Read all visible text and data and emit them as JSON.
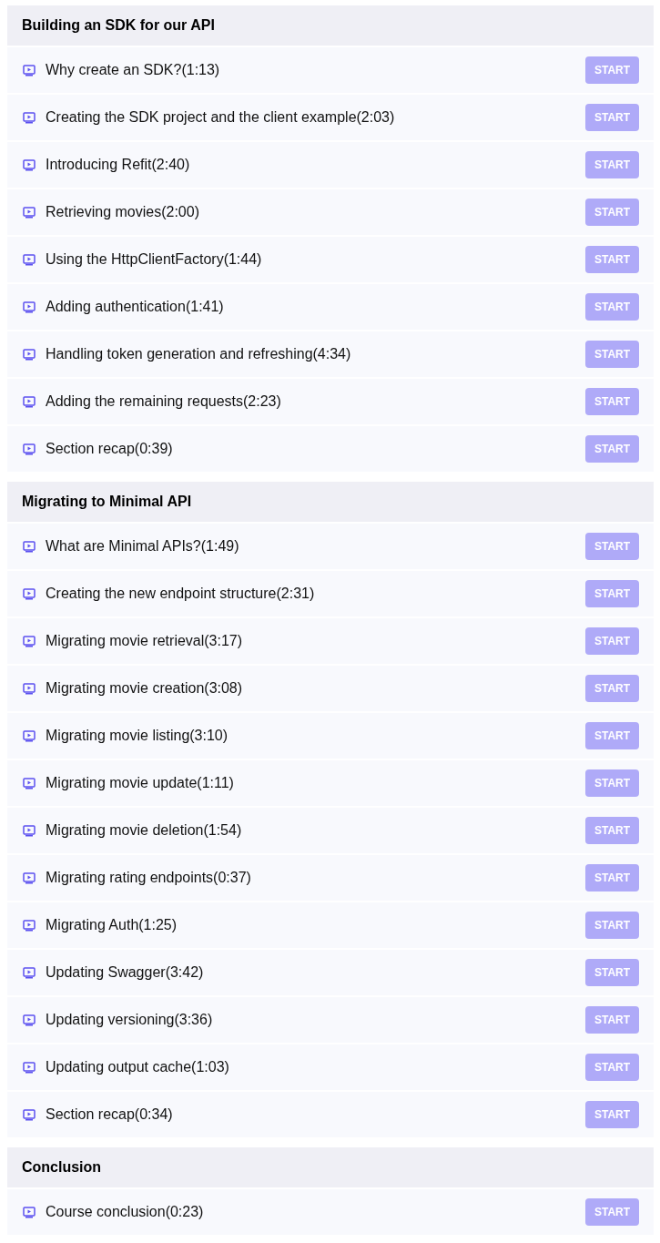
{
  "sections": [
    {
      "title": "Building an SDK for our API",
      "lessons": [
        {
          "title": "Why create an SDK?(1:13)",
          "button": "START"
        },
        {
          "title": "Creating the SDK project and the client example(2:03)",
          "button": "START"
        },
        {
          "title": "Introducing Refit(2:40)",
          "button": "START"
        },
        {
          "title": "Retrieving movies(2:00)",
          "button": "START"
        },
        {
          "title": "Using the HttpClientFactory(1:44)",
          "button": "START"
        },
        {
          "title": "Adding authentication(1:41)",
          "button": "START"
        },
        {
          "title": "Handling token generation and refreshing(4:34)",
          "button": "START"
        },
        {
          "title": "Adding the remaining requests(2:23)",
          "button": "START"
        },
        {
          "title": "Section recap(0:39)",
          "button": "START"
        }
      ]
    },
    {
      "title": "Migrating to Minimal API",
      "lessons": [
        {
          "title": "What are Minimal APIs?(1:49)",
          "button": "START"
        },
        {
          "title": "Creating the new endpoint structure(2:31)",
          "button": "START"
        },
        {
          "title": "Migrating movie retrieval(3:17)",
          "button": "START"
        },
        {
          "title": "Migrating movie creation(3:08)",
          "button": "START"
        },
        {
          "title": "Migrating movie listing(3:10)",
          "button": "START"
        },
        {
          "title": "Migrating movie update(1:11)",
          "button": "START"
        },
        {
          "title": "Migrating movie deletion(1:54)",
          "button": "START"
        },
        {
          "title": "Migrating rating endpoints(0:37)",
          "button": "START"
        },
        {
          "title": "Migrating Auth(1:25)",
          "button": "START"
        },
        {
          "title": "Updating Swagger(3:42)",
          "button": "START"
        },
        {
          "title": "Updating versioning(3:36)",
          "button": "START"
        },
        {
          "title": "Updating output cache(1:03)",
          "button": "START"
        },
        {
          "title": "Section recap(0:34)",
          "button": "START"
        }
      ]
    },
    {
      "title": "Conclusion",
      "lessons": [
        {
          "title": "Course conclusion(0:23)",
          "button": "START"
        }
      ]
    }
  ]
}
